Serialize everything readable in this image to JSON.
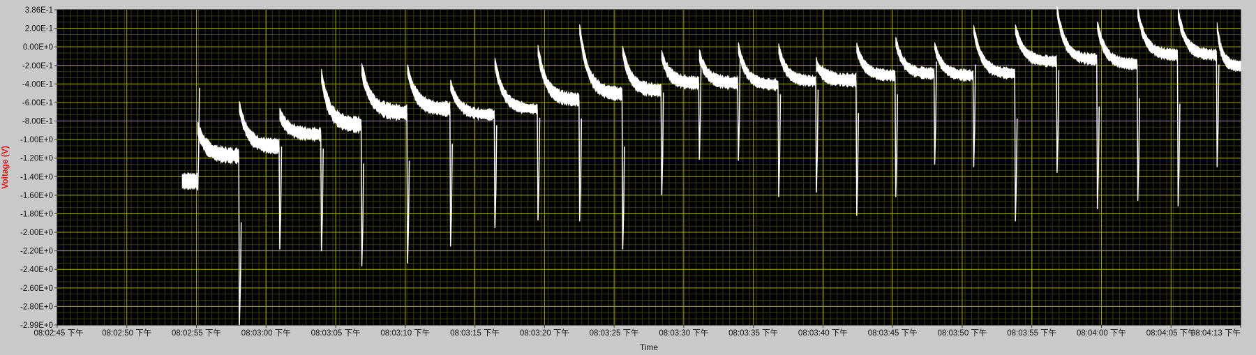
{
  "chart_data": {
    "type": "line",
    "title": "",
    "xlabel": "Time",
    "ylabel": "Voltage (V)",
    "x_ticks": [
      "08:02:45 下午",
      "08:02:50 下午",
      "08:02:55 下午",
      "08:03:00 下午",
      "08:03:05 下午",
      "08:03:10 下午",
      "08:03:15 下午",
      "08:03:20 下午",
      "08:03:25 下午",
      "08:03:30 下午",
      "08:03:35 下午",
      "08:03:40 下午",
      "08:03:45 下午",
      "08:03:50 下午",
      "08:03:55 下午",
      "08:04:00 下午",
      "08:04:05 下午",
      "08:04:13 下午"
    ],
    "y_ticks": [
      "3.86E-1",
      "2.00E-1",
      "0.00E+0",
      "-2.00E-1",
      "-4.00E-1",
      "-6.00E-1",
      "-8.00E-1",
      "-1.00E+0",
      "-1.20E+0",
      "-1.40E+0",
      "-1.60E+0",
      "-1.80E+0",
      "-2.00E+0",
      "-2.20E+0",
      "-2.40E+0",
      "-2.60E+0",
      "-2.80E+0",
      "-2.99E+0"
    ],
    "xlim_seconds": [
      0,
      88
    ],
    "ylim": [
      -2.99,
      0.386
    ],
    "grid": true,
    "colors": {
      "plot_bg": "#000000",
      "grid_major": "#a3a31a",
      "grid_minor": "#3a3a10",
      "trace": "#ffffff",
      "ylabel": "#e01010",
      "frame": "#c9c9c9"
    },
    "series": [
      {
        "segments": [
          {
            "t0": 9.3,
            "t1": 10.4,
            "start": -1.45,
            "settle": -1.45,
            "band": 0.14,
            "drop": -1.55
          },
          {
            "t0": 10.45,
            "t1": 13.5,
            "start": -0.88,
            "settle": -1.18,
            "band": 0.14,
            "drop": -2.99
          },
          {
            "t0": 13.55,
            "t1": 16.5,
            "start": -0.65,
            "settle": -1.08,
            "band": 0.13,
            "drop": -2.18
          },
          {
            "t0": 16.55,
            "t1": 19.6,
            "start": -0.73,
            "settle": -0.95,
            "band": 0.12,
            "drop": -2.2
          },
          {
            "t0": 19.65,
            "t1": 22.6,
            "start": -0.32,
            "settle": -0.85,
            "band": 0.14,
            "drop": -2.36
          },
          {
            "t0": 22.65,
            "t1": 26.0,
            "start": -0.25,
            "settle": -0.72,
            "band": 0.14,
            "drop": -2.33
          },
          {
            "t0": 26.05,
            "t1": 29.2,
            "start": -0.25,
            "settle": -0.68,
            "band": 0.13,
            "drop": -2.15
          },
          {
            "t0": 29.25,
            "t1": 32.5,
            "start": -0.42,
            "settle": -0.74,
            "band": 0.1,
            "drop": -1.95
          },
          {
            "t0": 32.55,
            "t1": 35.7,
            "start": -0.18,
            "settle": -0.68,
            "band": 0.1,
            "drop": -1.87
          },
          {
            "t0": 35.75,
            "t1": 38.8,
            "start": -0.05,
            "settle": -0.58,
            "band": 0.12,
            "drop": -1.88
          },
          {
            "t0": 38.85,
            "t1": 42.0,
            "start": 0.18,
            "settle": -0.52,
            "band": 0.12,
            "drop": -2.18
          },
          {
            "t0": 42.05,
            "t1": 44.9,
            "start": -0.05,
            "settle": -0.48,
            "band": 0.12,
            "drop": -1.6
          },
          {
            "t0": 44.95,
            "t1": 47.7,
            "start": -0.1,
            "settle": -0.4,
            "band": 0.12,
            "drop": -1.22
          },
          {
            "t0": 47.75,
            "t1": 50.6,
            "start": -0.1,
            "settle": -0.4,
            "band": 0.11,
            "drop": -1.23
          },
          {
            "t0": 50.65,
            "t1": 53.6,
            "start": -0.02,
            "settle": -0.42,
            "band": 0.1,
            "drop": -1.62
          },
          {
            "t0": 53.65,
            "t1": 56.4,
            "start": -0.03,
            "settle": -0.38,
            "band": 0.1,
            "drop": -1.57
          },
          {
            "t0": 56.45,
            "t1": 59.4,
            "start": -0.2,
            "settle": -0.37,
            "band": 0.12,
            "drop": -1.82
          },
          {
            "t0": 59.45,
            "t1": 62.3,
            "start": -0.02,
            "settle": -0.32,
            "band": 0.1,
            "drop": -1.62
          },
          {
            "t0": 62.35,
            "t1": 65.2,
            "start": 0.05,
            "settle": -0.3,
            "band": 0.1,
            "drop": -1.27
          },
          {
            "t0": 65.25,
            "t1": 68.1,
            "start": 0.0,
            "settle": -0.32,
            "band": 0.1,
            "drop": -1.3
          },
          {
            "t0": 68.15,
            "t1": 71.2,
            "start": 0.18,
            "settle": -0.3,
            "band": 0.1,
            "drop": -1.88
          },
          {
            "t0": 71.25,
            "t1": 74.3,
            "start": 0.18,
            "settle": -0.17,
            "band": 0.1,
            "drop": -1.36
          },
          {
            "t0": 74.35,
            "t1": 77.3,
            "start": 0.38,
            "settle": -0.15,
            "band": 0.1,
            "drop": -1.75
          },
          {
            "t0": 77.35,
            "t1": 80.3,
            "start": 0.22,
            "settle": -0.2,
            "band": 0.1,
            "drop": -1.66
          },
          {
            "t0": 80.35,
            "t1": 83.3,
            "start": 0.36,
            "settle": -0.1,
            "band": 0.1,
            "drop": -1.72
          },
          {
            "t0": 83.35,
            "t1": 86.2,
            "start": 0.35,
            "settle": -0.1,
            "band": 0.1,
            "drop": -1.3
          },
          {
            "t0": 86.25,
            "t1": 88.0,
            "start": 0.2,
            "settle": -0.22,
            "band": 0.1,
            "drop": null
          }
        ]
      }
    ]
  }
}
